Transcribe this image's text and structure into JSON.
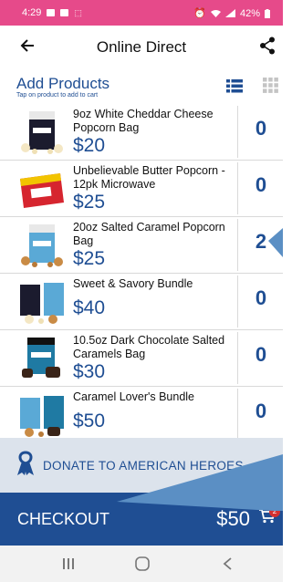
{
  "status_bar": {
    "time": "4:29",
    "battery": "42%"
  },
  "app_bar": {
    "title": "Online Direct"
  },
  "add_products": {
    "heading": "Add Products",
    "subheading": "Tap on product to add to cart"
  },
  "products": [
    {
      "name": "9oz White Cheddar Cheese Popcorn Bag",
      "price": "$20",
      "qty": "0",
      "icon": "white-cheddar-popcorn-bag-icon"
    },
    {
      "name": "Unbelievable Butter Popcorn - 12pk Microwave",
      "price": "$25",
      "qty": "0",
      "icon": "butter-popcorn-box-icon"
    },
    {
      "name": "20oz Salted Caramel Popcorn Bag",
      "price": "$25",
      "qty": "2",
      "icon": "salted-caramel-popcorn-bag-icon"
    },
    {
      "name": "Sweet & Savory Bundle",
      "price": "$40",
      "qty": "0",
      "icon": "sweet-savory-bundle-icon"
    },
    {
      "name": "10.5oz Dark Chocolate Salted Caramels Bag",
      "price": "$30",
      "qty": "0",
      "icon": "dark-chocolate-caramels-bag-icon"
    },
    {
      "name": "Caramel Lover's Bundle",
      "price": "$50",
      "qty": "0",
      "icon": "caramel-lovers-bundle-icon"
    }
  ],
  "donate": {
    "label": "DONATE TO AMERICAN HEROES"
  },
  "checkout": {
    "label": "CHECKOUT",
    "total": "$50",
    "cart_count": "2"
  },
  "colors": {
    "brand_blue": "#1f4e93",
    "status_bar": "#e64a8a",
    "donate_bg": "#dce3ec",
    "tooltip": "#5b8fc4"
  }
}
